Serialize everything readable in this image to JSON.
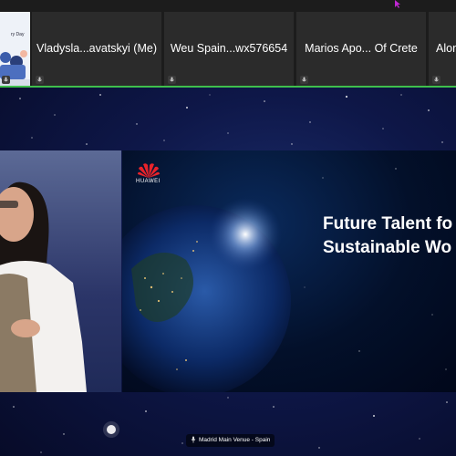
{
  "participants": [
    {
      "name": "Vladysla...avatskyi (Me)"
    },
    {
      "name": "Weu Spain...wx576654"
    },
    {
      "name": "Marios Apo... Of Crete"
    },
    {
      "name": "Alon"
    }
  ],
  "thumbnail": {
    "text": "ry Day"
  },
  "slide": {
    "brand": "HUAWEI",
    "title": "Future Talent fo\nSustainable Wo"
  },
  "venue_label": "Madrid Main Venue - Spain",
  "colors": {
    "active_speaker": "#3fbf4c",
    "strip_bg": "#1c1c1c",
    "tile_bg": "#2b2b2b"
  },
  "icons": {
    "mic": "mic-icon",
    "pointer": "pointer-cursor-icon",
    "logo": "huawei-logo-icon"
  }
}
